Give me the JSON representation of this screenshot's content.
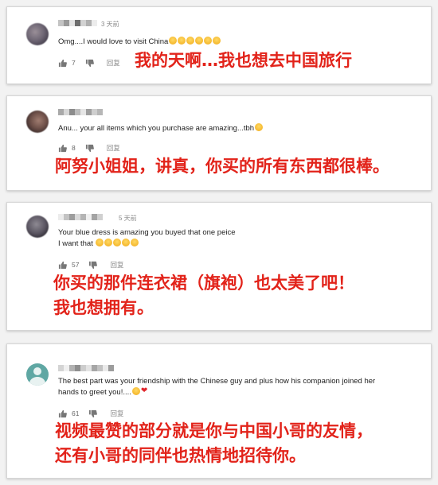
{
  "comments": [
    {
      "time": "3 天前",
      "text": "Omg....I would love to visit China",
      "emojis": [
        "heart-eyes",
        "heart-eyes",
        "heart-eyes",
        "heart-eyes",
        "heart-eyes",
        "heart-eyes"
      ],
      "likes": "7",
      "reply_label": "回复",
      "translation": [
        "我的天啊…我也想去中国旅行"
      ]
    },
    {
      "time": "",
      "text": "Anu... your all items which you purchase are amazing...tbh",
      "emojis": [
        "smile"
      ],
      "likes": "8",
      "reply_label": "回复",
      "translation": [
        "阿努小姐姐，讲真，你买的所有东西都很棒。"
      ]
    },
    {
      "time": "5 天前",
      "text_lines": [
        "Your blue dress is amazing you buyed that one peice",
        "I want that"
      ],
      "emojis": [
        "smile",
        "smile",
        "heart-eyes",
        "heart-eyes",
        "smile"
      ],
      "likes": "57",
      "reply_label": "回复",
      "translation": [
        "你买的那件连衣裙（旗袍）也太美了吧！",
        "我也想拥有。"
      ]
    },
    {
      "time": "",
      "text_lines": [
        "The best part was your friendship with the Chinese guy and plus how his companion joined her",
        "hands to greet you!...."
      ],
      "emojis": [
        "smile",
        "heart"
      ],
      "likes": "61",
      "reply_label": "回复",
      "translation": [
        "视频最赞的部分就是你与中国小哥的友情，",
        "还有小哥的同伴也热情地招待你。"
      ]
    }
  ],
  "colors": {
    "translation": "#e2231a",
    "timestamp": "#8a8a8a",
    "avatar_default": "#5fa7a3"
  },
  "icons": {
    "like": "thumbs-up-icon",
    "dislike": "thumbs-down-icon"
  }
}
